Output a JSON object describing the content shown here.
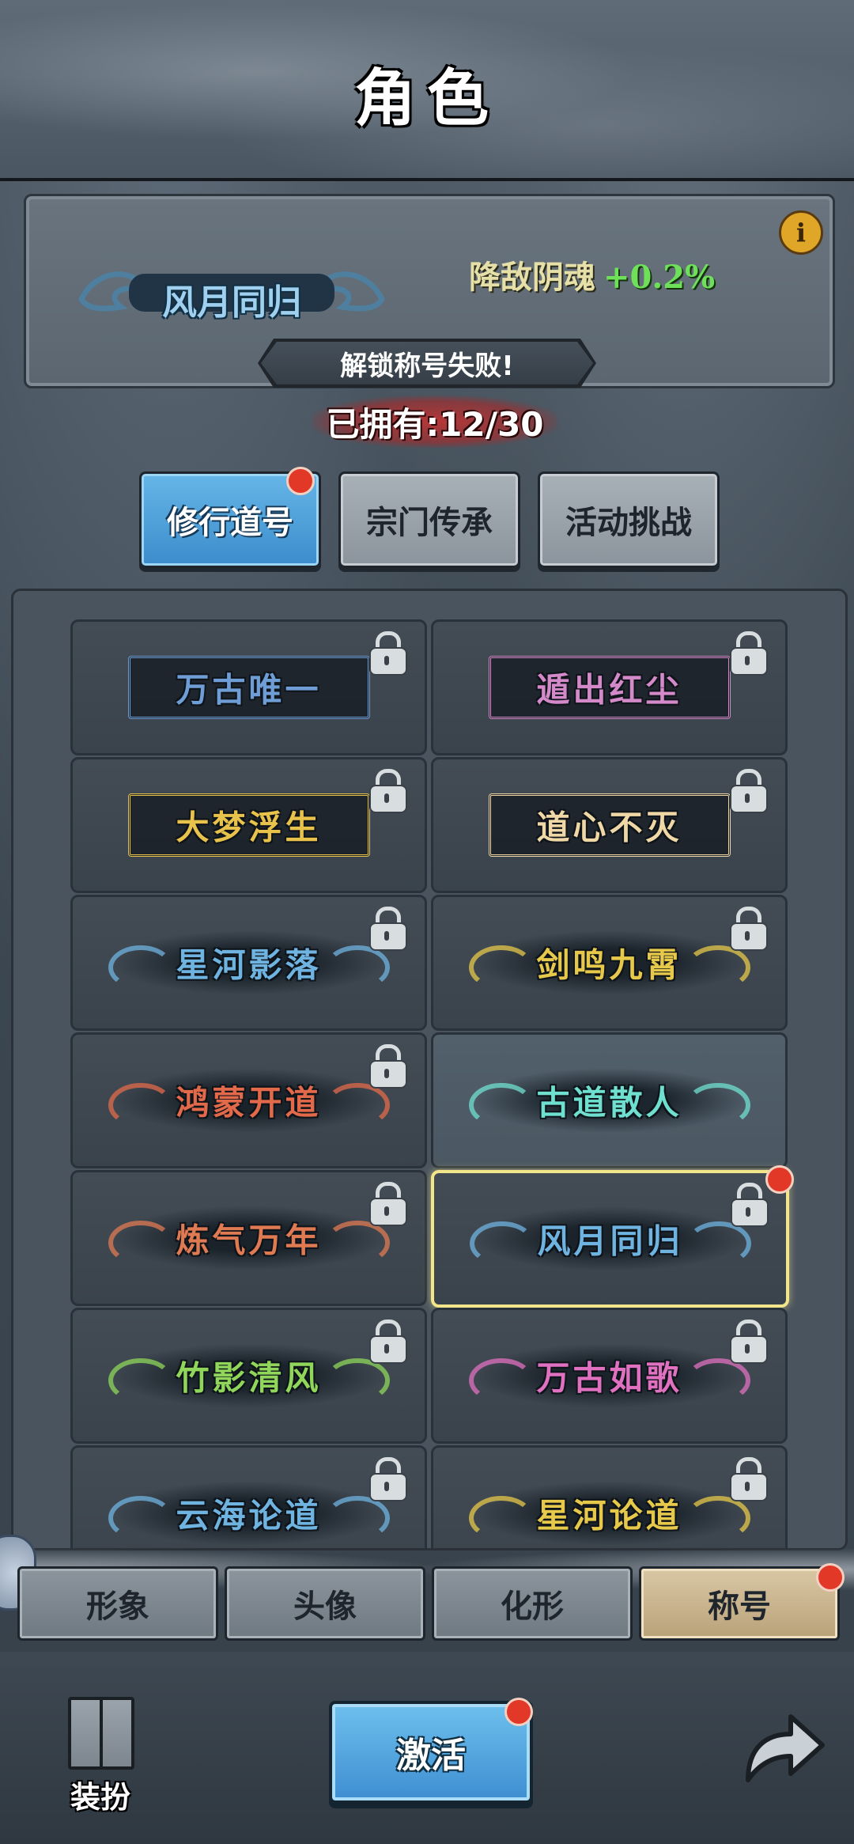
{
  "header": {
    "title": "角色"
  },
  "current_title": {
    "name": "风月同归",
    "name_color": "#9fd0f0",
    "stat_label": "降敌阴魂",
    "stat_value": "+0.2%",
    "info_label": "i",
    "status_message": "解锁称号失败!"
  },
  "owned": {
    "text": "已拥有:12/30"
  },
  "category_tabs": [
    {
      "label": "修行道号",
      "active": true,
      "badge": true
    },
    {
      "label": "宗门传承",
      "active": false,
      "badge": false
    },
    {
      "label": "活动挑战",
      "active": false,
      "badge": false
    }
  ],
  "titles": [
    {
      "name": "万古唯一",
      "color": "#6f9ed6",
      "style": "boxed",
      "locked": true
    },
    {
      "name": "遁出红尘",
      "color": "#d489c8",
      "style": "boxed",
      "locked": true
    },
    {
      "name": "大梦浮生",
      "color": "#e8c24a",
      "style": "boxed",
      "locked": true
    },
    {
      "name": "道心不灭",
      "color": "#f0d8a6",
      "style": "boxed",
      "locked": true
    },
    {
      "name": "星河影落",
      "color": "#6fb3e0",
      "style": "cloud",
      "locked": true
    },
    {
      "name": "剑鸣九霄",
      "color": "#e6c84a",
      "style": "cloud",
      "locked": true
    },
    {
      "name": "鸿蒙开道",
      "color": "#e26a4a",
      "style": "cloud",
      "locked": true
    },
    {
      "name": "古道散人",
      "color": "#6fe0d0",
      "style": "cloud",
      "locked": false
    },
    {
      "name": "炼气万年",
      "color": "#e07a52",
      "style": "cloud",
      "locked": true
    },
    {
      "name": "风月同归",
      "color": "#6fb3e0",
      "style": "cloud",
      "locked": true,
      "selected": true,
      "badge": true
    },
    {
      "name": "竹影清风",
      "color": "#8fd65a",
      "style": "cloud",
      "locked": true
    },
    {
      "name": "万古如歌",
      "color": "#e070c0",
      "style": "cloud",
      "locked": true
    },
    {
      "name": "云海论道",
      "color": "#6fb3e0",
      "style": "cloud",
      "locked": true
    },
    {
      "name": "星河论道",
      "color": "#e6c84a",
      "style": "cloud",
      "locked": true
    }
  ],
  "bottom_tabs": [
    {
      "label": "形象",
      "active": false,
      "badge": false
    },
    {
      "label": "头像",
      "active": false,
      "badge": false
    },
    {
      "label": "化形",
      "active": false,
      "badge": false
    },
    {
      "label": "称号",
      "active": true,
      "badge": true
    }
  ],
  "footer": {
    "wardrobe_label": "装扮",
    "activate_label": "激活",
    "activate_badge": true,
    "back_icon": "back-arrow-icon"
  }
}
